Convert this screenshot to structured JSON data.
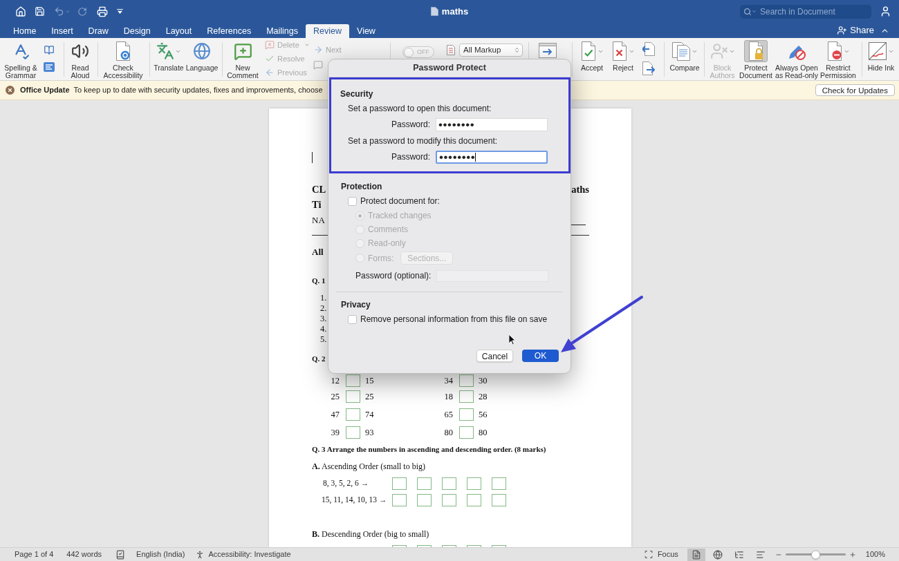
{
  "title_bar": {
    "quick_access": [
      {
        "disabled": false
      },
      {
        "disabled": false
      },
      {
        "disabled": true
      },
      {
        "disabled": true
      },
      {
        "disabled": false
      }
    ],
    "document_title": "maths",
    "search": {
      "placeholder": "Search in Document"
    }
  },
  "tabs": [
    {
      "label": "Home",
      "selected": false
    },
    {
      "label": "Insert",
      "selected": false
    },
    {
      "label": "Draw",
      "selected": false
    },
    {
      "label": "Design",
      "selected": false
    },
    {
      "label": "Layout",
      "selected": false
    },
    {
      "label": "References",
      "selected": false
    },
    {
      "label": "Mailings",
      "selected": false
    },
    {
      "label": "Review",
      "selected": true
    },
    {
      "label": "View",
      "selected": false
    }
  ],
  "share": {
    "label": "Share"
  },
  "ribbon": {
    "buttons": [
      {
        "label": "Spelling &\nGrammar",
        "disabled": false,
        "active": false
      },
      {
        "label": "Read\nAloud",
        "disabled": false,
        "active": false
      },
      {
        "label": "Check\nAccessibility",
        "disabled": false,
        "active": false
      },
      {
        "label": "Translate",
        "disabled": false,
        "active": false
      },
      {
        "label": "Language",
        "disabled": false,
        "active": false
      },
      {
        "label": "New\nComment",
        "disabled": false,
        "active": false
      },
      {
        "label": "Delete",
        "disabled": true,
        "active": false
      },
      {
        "label": "Resolve",
        "disabled": true,
        "active": false
      },
      {
        "label": "Previous",
        "disabled": true,
        "active": false
      },
      {
        "label": "Next",
        "disabled": true,
        "active": false
      },
      {
        "label": "Accept",
        "disabled": false,
        "active": false
      },
      {
        "label": "Reject",
        "disabled": false,
        "active": false
      },
      {
        "label": "Compare",
        "disabled": false,
        "active": false
      },
      {
        "label": "Block\nAuthors",
        "disabled": true,
        "active": false
      },
      {
        "label": "Protect\nDocument",
        "disabled": false,
        "active": true
      },
      {
        "label": "Always Open\nas Read-only",
        "disabled": false,
        "active": false
      },
      {
        "label": "Restrict\nPermission",
        "disabled": false,
        "active": false
      },
      {
        "label": "Hide Ink",
        "disabled": false,
        "active": false
      }
    ],
    "track_changes_switch": {
      "label": "OFF",
      "on": false
    },
    "markup_select": {
      "value": "All Markup"
    }
  },
  "message_bar": {
    "title": "Office Update",
    "text": "To keep up to date with security updates, fixes and improvements, choose",
    "button": "Check for Updates"
  },
  "document": {
    "header_lines": [
      {
        "left": "CL",
        "right": "aths"
      },
      {
        "left": "Ti"
      },
      {
        "left": "NA"
      }
    ],
    "instruction": "All",
    "question_1": {
      "label": "Q. 1",
      "items": [
        "1.",
        "2.",
        "3.",
        "4.",
        "5."
      ]
    },
    "question_2": {
      "label": "Q. 2",
      "rows": [
        {
          "pairs": [
            {
              "first": "12",
              "second": "15"
            },
            {
              "first": "34",
              "second": "30"
            }
          ]
        },
        {
          "pairs": [
            {
              "first": "25",
              "second": "25"
            },
            {
              "first": "18",
              "second": "28"
            }
          ]
        },
        {
          "pairs": [
            {
              "first": "47",
              "second": "74"
            },
            {
              "first": "65",
              "second": "56"
            }
          ]
        },
        {
          "pairs": [
            {
              "first": "39",
              "second": "93"
            },
            {
              "first": "80",
              "second": "80"
            }
          ]
        }
      ]
    },
    "question_3": {
      "heading": "Q. 3 Arrange the numbers in ascending and descending order. (8 marks)",
      "part_a": {
        "title": "**A.** Ascending Order (small to big)",
        "sequences": [
          "8, 3, 5, 2, 6 →",
          "15, 11, 14, 10, 13 →"
        ]
      },
      "part_b": {
        "title": "**B.** Descending Order (big to small)"
      }
    }
  },
  "dialog": {
    "title": "Password Protect",
    "security": {
      "heading": "Security",
      "fields": [
        {
          "prompt": "Set a password to open this document:",
          "label": "Password:",
          "value": "••••••••",
          "focused": false
        },
        {
          "prompt": "Set a password to modify this document:",
          "label": "Password:",
          "value": "••••••••",
          "focused": true
        }
      ]
    },
    "protection": {
      "heading": "Protection",
      "checkbox": {
        "label": "Protect document for:",
        "checked": false
      },
      "options": [
        {
          "label": "Tracked changes",
          "selected": true
        },
        {
          "label": "Comments",
          "selected": false
        },
        {
          "label": "Read-only",
          "selected": false
        },
        {
          "label": "Forms:",
          "selected": false
        }
      ],
      "sections_button": "Sections...",
      "password_label": "Password (optional):"
    },
    "privacy": {
      "heading": "Privacy",
      "checkbox": {
        "label": "Remove personal information from this file on save",
        "checked": false
      }
    },
    "buttons": [
      {
        "label": "Cancel",
        "default": false
      },
      {
        "label": "OK",
        "default": true
      }
    ]
  },
  "status_bar": {
    "page": "Page 1 of 4",
    "words": "442 words",
    "language": "English (India)",
    "accessibility": "Accessibility: Investigate",
    "focus": "Focus",
    "views": [
      {
        "selected": true
      },
      {
        "selected": false
      },
      {
        "selected": false
      },
      {
        "selected": false
      }
    ],
    "zoom": {
      "level": 0.5,
      "reading": "100%"
    }
  }
}
